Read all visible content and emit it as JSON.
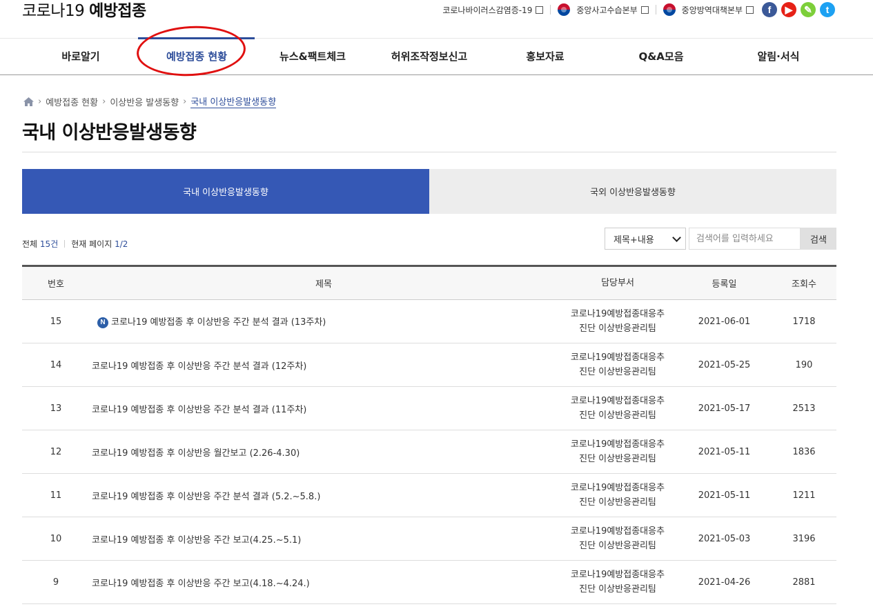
{
  "header": {
    "site_title_part1": "코로나19",
    "site_title_part2": "예방접종",
    "links": [
      {
        "label": "코로나바이러스감염증-19"
      },
      {
        "label": "중앙사고수습본부"
      },
      {
        "label": "중앙방역대책본부"
      }
    ],
    "social": [
      {
        "icon": "facebook-icon",
        "glyph": "f",
        "color": "#3b5998"
      },
      {
        "icon": "youtube-icon",
        "glyph": "▶",
        "color": "#e62117"
      },
      {
        "icon": "blog-icon",
        "glyph": "✎",
        "color": "#7dcf3a"
      },
      {
        "icon": "twitter-icon",
        "glyph": "t",
        "color": "#1da1f2"
      }
    ]
  },
  "gnb": {
    "items": [
      "바로알기",
      "예방접종 현황",
      "뉴스&팩트체크",
      "허위조작정보신고",
      "홍보자료",
      "Q&A모음",
      "알림·서식"
    ],
    "active": "예방접종 현황"
  },
  "breadcrumb": {
    "items": [
      "예방접종 현황",
      "이상반응 발생동향"
    ],
    "current": "국내 이상반응발생동향"
  },
  "page_title": "국내 이상반응발생동향",
  "tabs": [
    {
      "label": "국내 이상반응발생동향",
      "active": true
    },
    {
      "label": "국외 이상반응발생동향",
      "active": false
    }
  ],
  "summary": {
    "total_label": "전체",
    "total_value": "15건",
    "page_label": "현재 페이지",
    "page_value": "1/2"
  },
  "search": {
    "select_value": "제목+내용",
    "placeholder": "검색어를 입력하세요",
    "button_label": "검색"
  },
  "table": {
    "headers": [
      "번호",
      "제목",
      "담당부서",
      "등록일",
      "조회수"
    ],
    "rows": [
      {
        "num": "15",
        "is_new": true,
        "new_glyph": "N",
        "title": "코로나19 예방접종 후 이상반응 주간 분석 결과 (13주차)",
        "dept_line1": "코로나19예방접종대응추",
        "dept_line2": "진단 이상반응관리팀",
        "date": "2021-06-01",
        "hits": "1718"
      },
      {
        "num": "14",
        "is_new": false,
        "title": "코로나19 예방접종 후 이상반응 주간 분석 결과 (12주차)",
        "dept_line1": "코로나19예방접종대응추",
        "dept_line2": "진단 이상반응관리팀",
        "date": "2021-05-25",
        "hits": "190"
      },
      {
        "num": "13",
        "is_new": false,
        "title": "코로나19 예방접종 후 이상반응 주간 분석 결과 (11주차)",
        "dept_line1": "코로나19예방접종대응추",
        "dept_line2": "진단 이상반응관리팀",
        "date": "2021-05-17",
        "hits": "2513"
      },
      {
        "num": "12",
        "is_new": false,
        "title": "코로나19 예방접종 후 이상반응 월간보고 (2.26-4.30)",
        "dept_line1": "코로나19예방접종대응추",
        "dept_line2": "진단 이상반응관리팀",
        "date": "2021-05-11",
        "hits": "1836"
      },
      {
        "num": "11",
        "is_new": false,
        "title": "코로나19 예방접종 후 이상반응 주간 분석 결과 (5.2.~5.8.)",
        "dept_line1": "코로나19예방접종대응추",
        "dept_line2": "진단 이상반응관리팀",
        "date": "2021-05-11",
        "hits": "1211"
      },
      {
        "num": "10",
        "is_new": false,
        "title": "코로나19 예방접종 후 이상반응 주간 보고(4.25.~5.1)",
        "dept_line1": "코로나19예방접종대응추",
        "dept_line2": "진단 이상반응관리팀",
        "date": "2021-05-03",
        "hits": "3196"
      },
      {
        "num": "9",
        "is_new": false,
        "title": "코로나19 예방접종 후 이상반응 주간 보고(4.18.~4.24.)",
        "dept_line1": "코로나19예방접종대응추",
        "dept_line2": "진단 이상반응관리팀",
        "date": "2021-04-26",
        "hits": "2881"
      }
    ]
  }
}
